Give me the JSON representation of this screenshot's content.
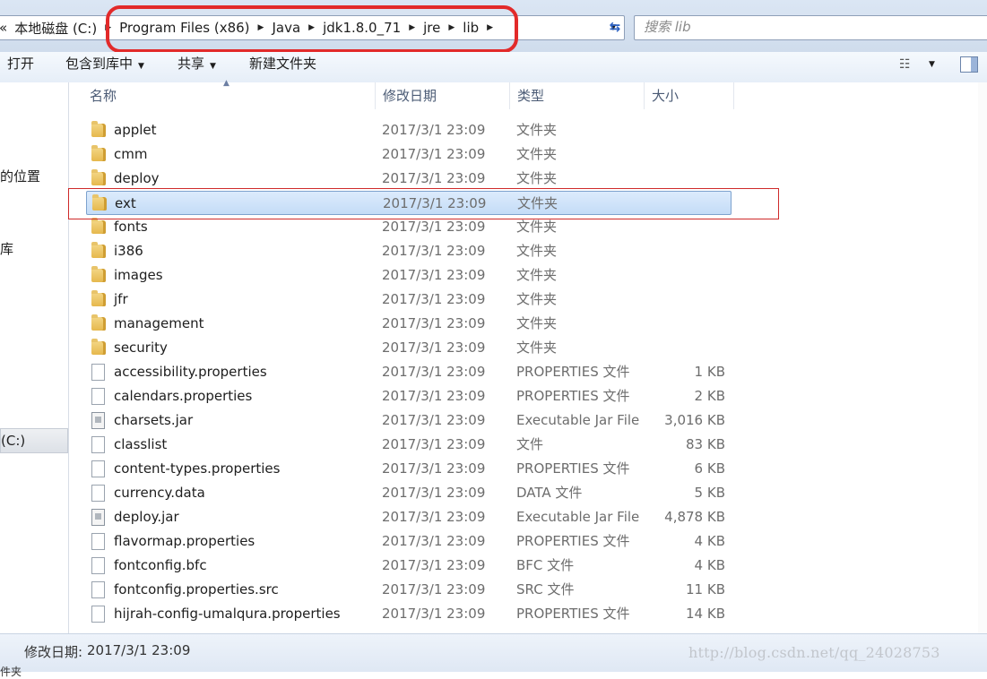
{
  "address_bar": {
    "leading_glyph": "«",
    "crumbs": [
      "本地磁盘 (C:)",
      "Program Files (x86)",
      "Java",
      "jdk1.8.0_71",
      "jre",
      "lib"
    ],
    "search_placeholder": "搜索 lib"
  },
  "toolbar": {
    "open": "打开",
    "include_in_library": "包含到库中",
    "share": "共享",
    "new_folder": "新建文件夹"
  },
  "nav": {
    "items": [
      "的位置",
      "库"
    ],
    "drive": "(C:)"
  },
  "columns": {
    "name": "名称",
    "date": "修改日期",
    "type": "类型",
    "size": "大小"
  },
  "files": [
    {
      "name": "applet",
      "date": "2017/3/1 23:09",
      "type": "文件夹",
      "size": "",
      "icon": "folder"
    },
    {
      "name": "cmm",
      "date": "2017/3/1 23:09",
      "type": "文件夹",
      "size": "",
      "icon": "folder"
    },
    {
      "name": "deploy",
      "date": "2017/3/1 23:09",
      "type": "文件夹",
      "size": "",
      "icon": "folder"
    },
    {
      "name": "ext",
      "date": "2017/3/1 23:09",
      "type": "文件夹",
      "size": "",
      "icon": "folder",
      "selected": true
    },
    {
      "name": "fonts",
      "date": "2017/3/1 23:09",
      "type": "文件夹",
      "size": "",
      "icon": "folder"
    },
    {
      "name": "i386",
      "date": "2017/3/1 23:09",
      "type": "文件夹",
      "size": "",
      "icon": "folder"
    },
    {
      "name": "images",
      "date": "2017/3/1 23:09",
      "type": "文件夹",
      "size": "",
      "icon": "folder"
    },
    {
      "name": "jfr",
      "date": "2017/3/1 23:09",
      "type": "文件夹",
      "size": "",
      "icon": "folder"
    },
    {
      "name": "management",
      "date": "2017/3/1 23:09",
      "type": "文件夹",
      "size": "",
      "icon": "folder"
    },
    {
      "name": "security",
      "date": "2017/3/1 23:09",
      "type": "文件夹",
      "size": "",
      "icon": "folder"
    },
    {
      "name": "accessibility.properties",
      "date": "2017/3/1 23:09",
      "type": "PROPERTIES 文件",
      "size": "1 KB",
      "icon": "file"
    },
    {
      "name": "calendars.properties",
      "date": "2017/3/1 23:09",
      "type": "PROPERTIES 文件",
      "size": "2 KB",
      "icon": "file"
    },
    {
      "name": "charsets.jar",
      "date": "2017/3/1 23:09",
      "type": "Executable Jar File",
      "size": "3,016 KB",
      "icon": "jar"
    },
    {
      "name": "classlist",
      "date": "2017/3/1 23:09",
      "type": "文件",
      "size": "83 KB",
      "icon": "file"
    },
    {
      "name": "content-types.properties",
      "date": "2017/3/1 23:09",
      "type": "PROPERTIES 文件",
      "size": "6 KB",
      "icon": "file"
    },
    {
      "name": "currency.data",
      "date": "2017/3/1 23:09",
      "type": "DATA 文件",
      "size": "5 KB",
      "icon": "file"
    },
    {
      "name": "deploy.jar",
      "date": "2017/3/1 23:09",
      "type": "Executable Jar File",
      "size": "4,878 KB",
      "icon": "jar"
    },
    {
      "name": "flavormap.properties",
      "date": "2017/3/1 23:09",
      "type": "PROPERTIES 文件",
      "size": "4 KB",
      "icon": "file"
    },
    {
      "name": "fontconfig.bfc",
      "date": "2017/3/1 23:09",
      "type": "BFC 文件",
      "size": "4 KB",
      "icon": "file"
    },
    {
      "name": "fontconfig.properties.src",
      "date": "2017/3/1 23:09",
      "type": "SRC 文件",
      "size": "11 KB",
      "icon": "file"
    },
    {
      "name": "hijrah-config-umalqura.properties",
      "date": "2017/3/1 23:09",
      "type": "PROPERTIES 文件",
      "size": "14 KB",
      "icon": "file"
    }
  ],
  "status": {
    "label": "修改日期:",
    "value": "2017/3/1 23:09",
    "glyph": "件夹"
  },
  "watermark": "http://blog.csdn.net/qq_24028753",
  "colors": {
    "annotation_red": "#e22a2a",
    "selection_blue": "#c4dcf7",
    "folder_yellow": "#e6b84d"
  }
}
